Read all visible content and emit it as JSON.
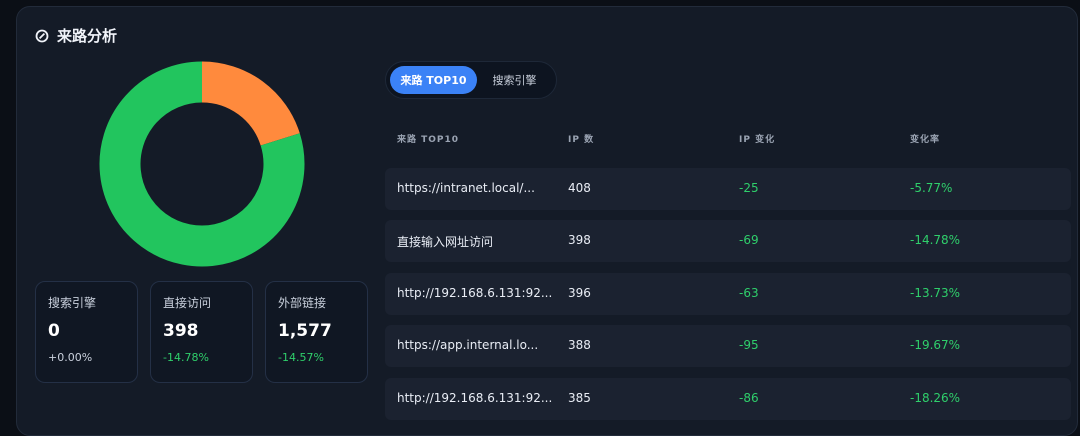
{
  "panel": {
    "title": "来路分析",
    "title_icon": "compass-icon"
  },
  "chart_data": {
    "type": "pie",
    "donut": true,
    "slices": [
      {
        "label": "外部链接",
        "value": 1577,
        "color": "#22c55e"
      },
      {
        "label": "直接访问",
        "value": 398,
        "color": "#ff8a3d"
      },
      {
        "label": "搜索引擎",
        "value": 0,
        "color": "#3b82f6"
      }
    ]
  },
  "stats": [
    {
      "label": "搜索引擎",
      "value": "0",
      "change": "+0.00%"
    },
    {
      "label": "直接访问",
      "value": "398",
      "change": "-14.78%"
    },
    {
      "label": "外部链接",
      "value": "1,577",
      "change": "-14.57%"
    }
  ],
  "tabs": [
    {
      "label": "来路 TOP10",
      "active": true
    },
    {
      "label": "搜索引擎",
      "active": false
    }
  ],
  "table": {
    "headers": [
      "来路 TOP10",
      "IP 数",
      "IP 变化",
      "变化率"
    ],
    "rows": [
      [
        "https://intranet.local/...",
        "408",
        "-25",
        "-5.77%"
      ],
      [
        "直接输入网址访问",
        "398",
        "-69",
        "-14.78%"
      ],
      [
        "http://192.168.6.131:92...",
        "396",
        "-63",
        "-13.73%"
      ],
      [
        "https://app.internal.lo...",
        "388",
        "-95",
        "-19.67%"
      ],
      [
        "http://192.168.6.131:92...",
        "385",
        "-86",
        "-18.26%"
      ]
    ]
  }
}
